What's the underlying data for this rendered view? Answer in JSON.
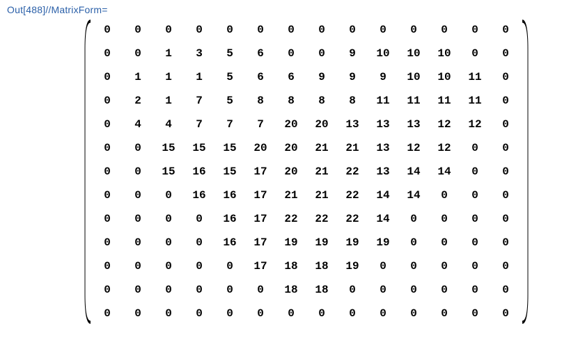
{
  "label": "Out[488]//MatrixForm=",
  "chart_data": {
    "type": "table",
    "title": "MatrixForm output",
    "rows": 13,
    "cols": 14,
    "values": [
      [
        0,
        0,
        0,
        0,
        0,
        0,
        0,
        0,
        0,
        0,
        0,
        0,
        0,
        0
      ],
      [
        0,
        0,
        1,
        3,
        5,
        6,
        0,
        0,
        9,
        10,
        10,
        10,
        0,
        0
      ],
      [
        0,
        1,
        1,
        1,
        5,
        6,
        6,
        9,
        9,
        9,
        10,
        10,
        11,
        0
      ],
      [
        0,
        2,
        1,
        7,
        5,
        8,
        8,
        8,
        8,
        11,
        11,
        11,
        11,
        0
      ],
      [
        0,
        4,
        4,
        7,
        7,
        7,
        20,
        20,
        13,
        13,
        13,
        12,
        12,
        0
      ],
      [
        0,
        0,
        15,
        15,
        15,
        20,
        20,
        21,
        21,
        13,
        12,
        12,
        0,
        0
      ],
      [
        0,
        0,
        15,
        16,
        15,
        17,
        20,
        21,
        22,
        13,
        14,
        14,
        0,
        0
      ],
      [
        0,
        0,
        0,
        16,
        16,
        17,
        21,
        21,
        22,
        14,
        14,
        0,
        0,
        0
      ],
      [
        0,
        0,
        0,
        0,
        16,
        17,
        22,
        22,
        22,
        14,
        0,
        0,
        0,
        0
      ],
      [
        0,
        0,
        0,
        0,
        16,
        17,
        19,
        19,
        19,
        19,
        0,
        0,
        0,
        0
      ],
      [
        0,
        0,
        0,
        0,
        0,
        17,
        18,
        18,
        19,
        0,
        0,
        0,
        0,
        0
      ],
      [
        0,
        0,
        0,
        0,
        0,
        0,
        18,
        18,
        0,
        0,
        0,
        0,
        0,
        0
      ],
      [
        0,
        0,
        0,
        0,
        0,
        0,
        0,
        0,
        0,
        0,
        0,
        0,
        0,
        0
      ]
    ]
  }
}
